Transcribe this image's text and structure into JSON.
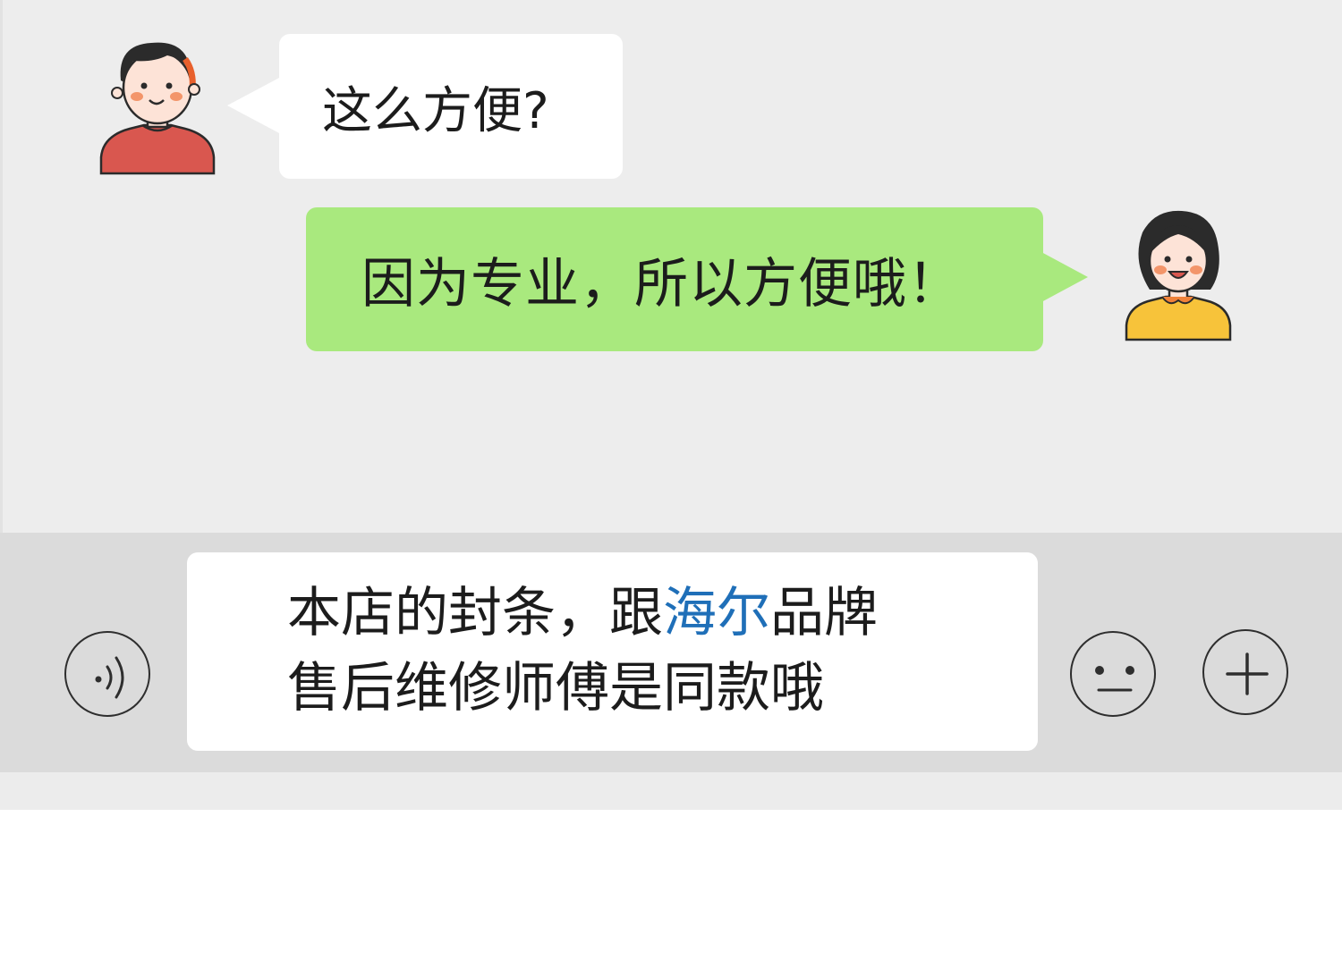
{
  "messages": [
    {
      "side": "left",
      "text": "这么方便?"
    },
    {
      "side": "right",
      "text": "因为专业，所以方便哦！"
    }
  ],
  "input": {
    "line1_before": "本店的封条，跟",
    "line1_brand": "海尔",
    "line1_after": "品牌",
    "line2": "售后维修师傅是同款哦"
  },
  "icons": {
    "voice": "voice-icon",
    "emoji": "emoji-icon",
    "more": "plus-icon"
  },
  "colors": {
    "chat_bg": "#ededed",
    "incoming_bubble": "#ffffff",
    "outgoing_bubble": "#a9e97e",
    "input_bar": "#dbdbdb",
    "brand_text": "#1f6fb8"
  }
}
